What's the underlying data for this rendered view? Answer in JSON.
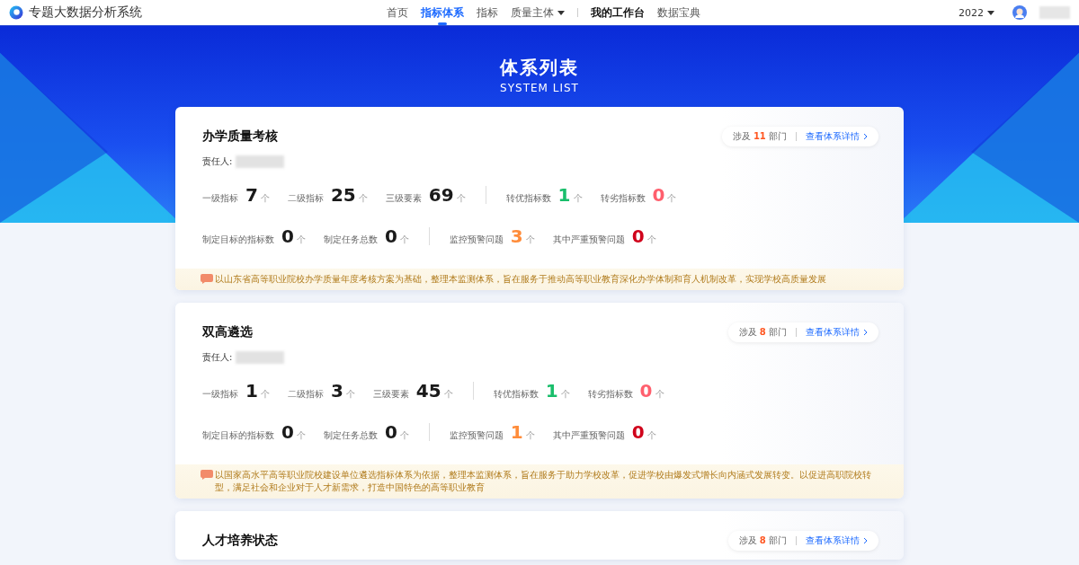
{
  "app_title": "专题大数据分析系统",
  "nav": [
    {
      "label": "首页",
      "kind": "link",
      "selected": false
    },
    {
      "label": "指标体系",
      "kind": "link",
      "selected": true
    },
    {
      "label": "指标",
      "kind": "link",
      "selected": false
    },
    {
      "label": "质量主体",
      "kind": "dropdown",
      "selected": false
    },
    {
      "label": "我的工作台",
      "kind": "emphasis",
      "selected": false
    },
    {
      "label": "数据宝典",
      "kind": "link",
      "selected": false
    }
  ],
  "year": "2022",
  "banner": {
    "title": "体系列表",
    "subtitle": "SYSTEM LIST"
  },
  "systems": [
    {
      "title": "办学质量考核",
      "owner_label": "责任人:",
      "dept_prefix": "涉及",
      "dept_count": "11",
      "dept_suffix": "部门",
      "detail_link": "查看体系详情",
      "stat_rows": [
        [
          [
            {
              "label": "一级指标",
              "value": "7",
              "unit": "个",
              "kind": "plain"
            },
            {
              "label": "二级指标",
              "value": "25",
              "unit": "个",
              "kind": "plain"
            },
            {
              "label": "三级要素",
              "value": "69",
              "unit": "个",
              "kind": "plain"
            }
          ],
          [
            {
              "label": "转优指标数",
              "value": "1",
              "unit": "个",
              "kind": "good"
            },
            {
              "label": "转劣指标数",
              "value": "0",
              "unit": "个",
              "kind": "bad"
            }
          ]
        ],
        [
          [
            {
              "label": "制定目标的指标数",
              "value": "0",
              "unit": "个",
              "kind": "plain"
            },
            {
              "label": "制定任务总数",
              "value": "0",
              "unit": "个",
              "kind": "plain"
            }
          ],
          [
            {
              "label": "监控预警问题",
              "value": "3",
              "unit": "个",
              "kind": "warning"
            },
            {
              "label": "其中严重预警问题",
              "value": "0",
              "unit": "个",
              "kind": "severe"
            }
          ]
        ]
      ],
      "note": "以山东省高等职业院校办学质量年度考核方案为基础，整理本监测体系，旨在服务于推动高等职业教育深化办学体制和育人机制改革，实现学校高质量发展"
    },
    {
      "title": "双高遴选",
      "owner_label": "责任人:",
      "dept_prefix": "涉及",
      "dept_count": "8",
      "dept_suffix": "部门",
      "detail_link": "查看体系详情",
      "stat_rows": [
        [
          [
            {
              "label": "一级指标",
              "value": "1",
              "unit": "个",
              "kind": "plain"
            },
            {
              "label": "二级指标",
              "value": "3",
              "unit": "个",
              "kind": "plain"
            },
            {
              "label": "三级要素",
              "value": "45",
              "unit": "个",
              "kind": "plain"
            }
          ],
          [
            {
              "label": "转优指标数",
              "value": "1",
              "unit": "个",
              "kind": "good"
            },
            {
              "label": "转劣指标数",
              "value": "0",
              "unit": "个",
              "kind": "bad"
            }
          ]
        ],
        [
          [
            {
              "label": "制定目标的指标数",
              "value": "0",
              "unit": "个",
              "kind": "plain"
            },
            {
              "label": "制定任务总数",
              "value": "0",
              "unit": "个",
              "kind": "plain"
            }
          ],
          [
            {
              "label": "监控预警问题",
              "value": "1",
              "unit": "个",
              "kind": "warning"
            },
            {
              "label": "其中严重预警问题",
              "value": "0",
              "unit": "个",
              "kind": "severe"
            }
          ]
        ]
      ],
      "note": "以国家高水平高等职业院校建设单位遴选指标体系为依据，整理本监测体系，旨在服务于助力学校改革，促进学校由爆发式增长向内涵式发展转变。以促进高职院校转型，满足社会和企业对于人才新需求，打造中国特色的高等职业教育"
    },
    {
      "title": "人才培养状态",
      "dept_prefix": "涉及",
      "dept_count": "8",
      "dept_suffix": "部门",
      "detail_link": "查看体系详情"
    }
  ]
}
